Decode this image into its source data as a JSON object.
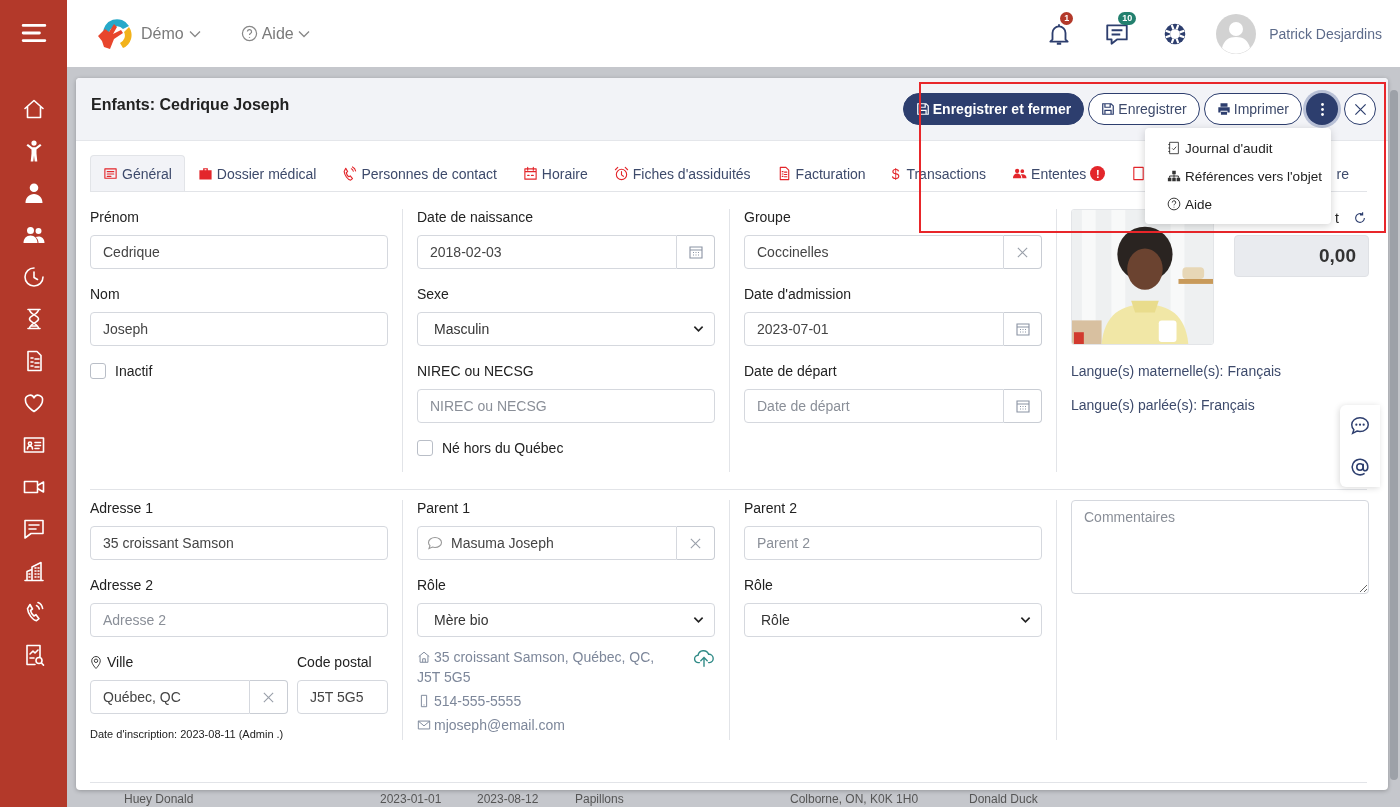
{
  "header": {
    "brand": "Démo",
    "help": "Aide",
    "notification_count": "1",
    "message_count": "10",
    "user_name": "Patrick Desjardins"
  },
  "record": {
    "title": "Enfants: Cedrique Joseph",
    "actions": [
      {
        "label": "Enregistrer et fermer",
        "kind": "primary"
      },
      {
        "label": "Enregistrer",
        "kind": "secondary"
      },
      {
        "label": "Imprimer",
        "kind": "secondary"
      }
    ],
    "more_menu": {
      "expanded": true,
      "items": [
        {
          "label": "Journal d'audit"
        },
        {
          "label": "Références vers l'objet"
        },
        {
          "label": "Aide"
        }
      ]
    }
  },
  "tabs": [
    {
      "label": "Général",
      "selected": true
    },
    {
      "label": "Dossier médical",
      "selected": false
    },
    {
      "label": "Personnes de contact",
      "selected": false
    },
    {
      "label": "Horaire",
      "selected": false
    },
    {
      "label": "Fiches d'assiduités",
      "selected": false
    },
    {
      "label": "Facturation",
      "selected": false
    },
    {
      "label": "Transactions",
      "selected": false,
      "symbol": "$"
    },
    {
      "label": "Ententes",
      "selected": false,
      "badge": "!"
    },
    {
      "label": "re",
      "selected": false
    }
  ],
  "sections": [
    {
      "kind": "general",
      "columns": [
        [
          {
            "kind": "text",
            "label": "Prénom",
            "value": "Cedrique"
          },
          {
            "kind": "text",
            "label": "Nom",
            "value": "Joseph"
          },
          {
            "kind": "checkbox",
            "label": "Inactif",
            "checked": false
          }
        ],
        [
          {
            "kind": "date",
            "label": "Date de naissance",
            "value": "2018-02-03"
          },
          {
            "kind": "select",
            "label": "Sexe",
            "value": "Masculin"
          },
          {
            "kind": "text",
            "label": "NIREC ou NECSG",
            "placeholder": "NIREC ou NECSG"
          },
          {
            "kind": "checkbox",
            "label": "Né hors du Québec",
            "checked": false
          }
        ],
        [
          {
            "kind": "clearable",
            "label": "Groupe",
            "value": "Coccinelles"
          },
          {
            "kind": "date",
            "label": "Date d'admission",
            "value": "2023-07-01"
          },
          {
            "kind": "date",
            "label": "Date de départ",
            "placeholder": "Date de départ"
          }
        ]
      ],
      "profile": {
        "balance_label": "t",
        "balance": "0,00",
        "languages": [
          "Langue(s) maternelle(s): Français",
          "Langue(s) parlée(s): Français"
        ]
      }
    },
    {
      "kind": "address",
      "columns": [
        [
          {
            "kind": "text",
            "label": "Adresse 1",
            "value": "35 croissant Samson"
          },
          {
            "kind": "text",
            "label": "Adresse 2",
            "placeholder": "Adresse 2"
          }
        ],
        [
          {
            "kind": "contact",
            "label": "Parent 1",
            "value": "Masuma Joseph"
          },
          {
            "kind": "select",
            "label": "Rôle",
            "value": "Mère bio"
          }
        ],
        [
          {
            "kind": "text",
            "label": "Parent 2",
            "placeholder": "Parent 2"
          },
          {
            "kind": "select",
            "label": "Rôle",
            "value": "Rôle"
          }
        ]
      ],
      "city": {
        "label": "Ville",
        "value": "Québec, QC"
      },
      "postal_code": {
        "label": "Code postal",
        "value": "J5T 5G5"
      },
      "registration": "Date d'inscription: 2023-08-11 (Admin .)",
      "parent_contact": {
        "address": "35 croissant Samson, Québec, QC, J5T 5G5",
        "phone": "514-555-5555",
        "email": "mjoseph@email.com"
      },
      "comments": {
        "placeholder": "Commentaires"
      }
    }
  ],
  "background_row": [
    "Huey Donald",
    "2023-01-01",
    "2023-08-12",
    "Papillons",
    "Colborne, ON, K0K 1H0",
    "Donald Duck"
  ]
}
